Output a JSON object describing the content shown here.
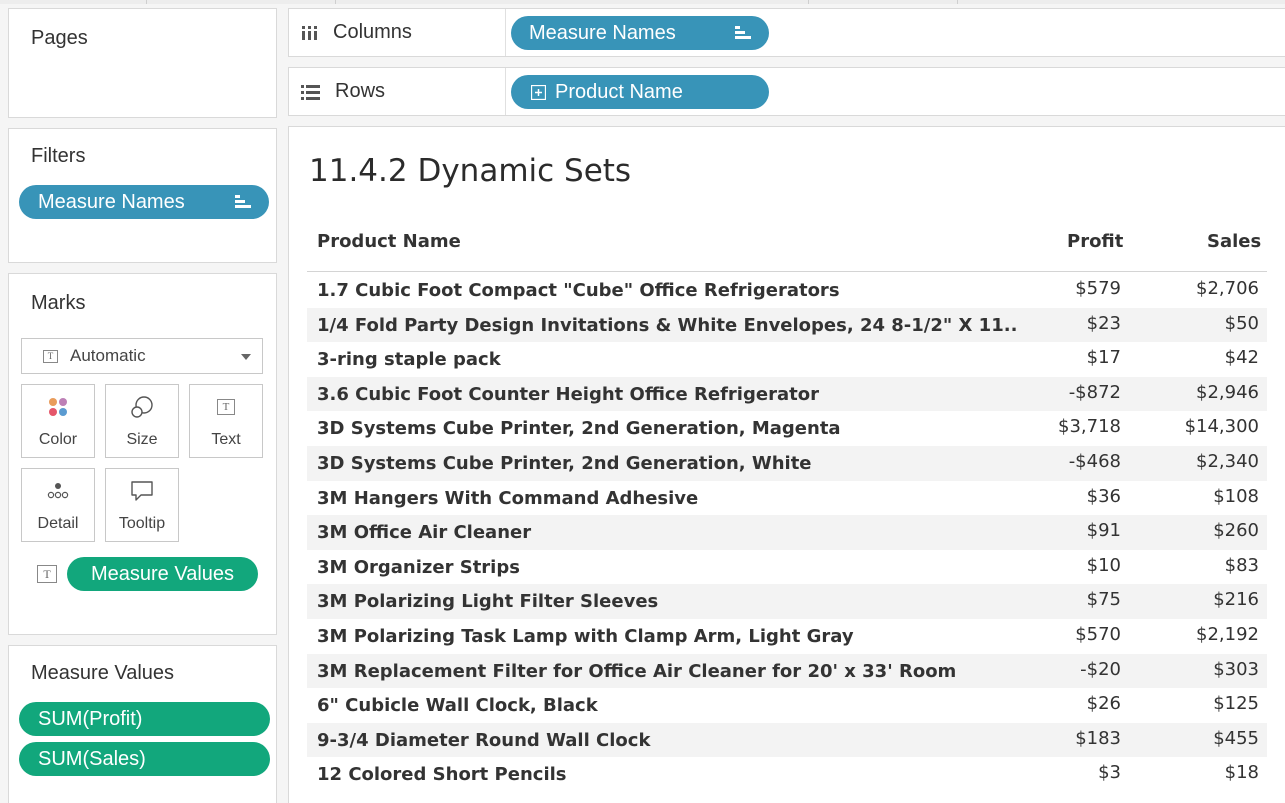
{
  "shelves": {
    "pages_label": "Pages",
    "columns_label": "Columns",
    "columns_pill": "Measure Names",
    "rows_label": "Rows",
    "rows_pill": "Product Name"
  },
  "filters": {
    "title": "Filters",
    "pill": "Measure Names"
  },
  "marks": {
    "title": "Marks",
    "mark_type": "Automatic",
    "buttons": [
      "Color",
      "Size",
      "Text",
      "Detail",
      "Tooltip"
    ],
    "text_pill": "Measure Values"
  },
  "measure_values": {
    "title": "Measure Values",
    "pills": [
      "SUM(Profit)",
      "SUM(Sales)"
    ]
  },
  "view": {
    "title": "11.4.2 Dynamic Sets",
    "headers": {
      "name": "Product Name",
      "profit": "Profit",
      "sales": "Sales"
    },
    "rows": [
      {
        "name": "1.7 Cubic Foot Compact \"Cube\" Office Refrigerators",
        "profit": "$579",
        "sales": "$2,706"
      },
      {
        "name": "1/4 Fold Party Design Invitations & White Envelopes, 24 8-1/2\" X 11..",
        "profit": "$23",
        "sales": "$50"
      },
      {
        "name": "3-ring staple pack",
        "profit": "$17",
        "sales": "$42"
      },
      {
        "name": "3.6 Cubic Foot Counter Height Office Refrigerator",
        "profit": "-$872",
        "sales": "$2,946"
      },
      {
        "name": "3D Systems Cube Printer, 2nd Generation, Magenta",
        "profit": "$3,718",
        "sales": "$14,300"
      },
      {
        "name": "3D Systems Cube Printer, 2nd Generation, White",
        "profit": "-$468",
        "sales": "$2,340"
      },
      {
        "name": "3M Hangers With Command Adhesive",
        "profit": "$36",
        "sales": "$108"
      },
      {
        "name": "3M Office Air Cleaner",
        "profit": "$91",
        "sales": "$260"
      },
      {
        "name": "3M Organizer Strips",
        "profit": "$10",
        "sales": "$83"
      },
      {
        "name": "3M Polarizing Light Filter Sleeves",
        "profit": "$75",
        "sales": "$216"
      },
      {
        "name": "3M Polarizing Task Lamp with Clamp Arm, Light Gray",
        "profit": "$570",
        "sales": "$2,192"
      },
      {
        "name": "3M Replacement Filter for Office Air Cleaner for 20' x 33' Room",
        "profit": "-$20",
        "sales": "$303"
      },
      {
        "name": "6\" Cubicle Wall Clock, Black",
        "profit": "$26",
        "sales": "$125"
      },
      {
        "name": "9-3/4 Diameter Round Wall Clock",
        "profit": "$183",
        "sales": "$455"
      },
      {
        "name": "12 Colored Short Pencils",
        "profit": "$3",
        "sales": "$18"
      }
    ]
  },
  "colors": {
    "dimension_pill": "#3894b8",
    "measure_pill": "#12a77c"
  }
}
